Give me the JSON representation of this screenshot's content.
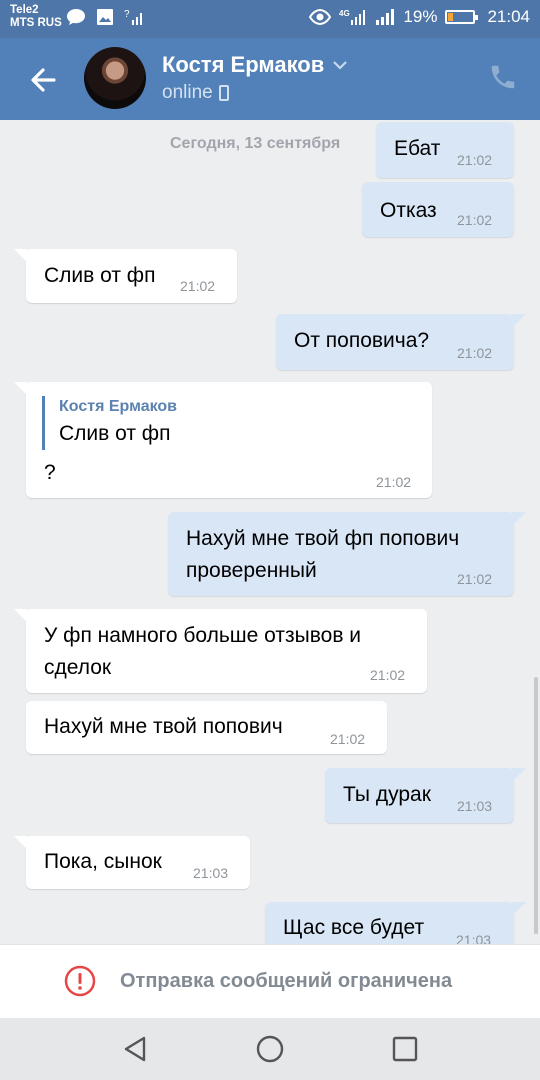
{
  "status_bar": {
    "carrier_1": "Tele2",
    "carrier_2": "MTS RUS",
    "network": "4G",
    "battery": "19%",
    "battery_level": 0.19,
    "time": "21:04",
    "left_icons": [
      "message-icon",
      "image-icon",
      "signal-unknown-icon"
    ],
    "right_icons": [
      "eye-icon",
      "4g-signal-icon",
      "signal-icon",
      "battery-icon"
    ]
  },
  "header": {
    "contact_name": "Костя Ермаков",
    "status": "online",
    "back_icon": "arrow-left-icon",
    "call_icon": "phone-icon",
    "colors": {
      "header_bg": "#5181b8",
      "status_bg": "#4f76a9"
    }
  },
  "chat": {
    "date": "Сегодня, 13 сентября",
    "messages": [
      {
        "dir": "out",
        "text": "Ебат",
        "time": "21:02"
      },
      {
        "dir": "out",
        "text": "Отказ",
        "time": "21:02"
      },
      {
        "dir": "in",
        "text": "Слив от фп",
        "time": "21:02"
      },
      {
        "dir": "out",
        "text": "От поповича?",
        "time": "21:02"
      },
      {
        "dir": "in",
        "quote_author": "Костя Ермаков",
        "quote_text": "Слив от фп",
        "text": "?",
        "time": "21:02"
      },
      {
        "dir": "out",
        "line1": "Нахуй мне твой фп попович",
        "line2": "проверенный",
        "time": "21:02"
      },
      {
        "dir": "in",
        "line1": "У фп намного больше отзывов и",
        "line2": "сделок",
        "time": "21:02"
      },
      {
        "dir": "in",
        "text": "Нахуй мне твой попович",
        "time": "21:02"
      },
      {
        "dir": "out",
        "text": "Ты дурак",
        "time": "21:03"
      },
      {
        "dir": "in",
        "text": "Пока, сынок",
        "time": "21:03"
      },
      {
        "dir": "out",
        "text": "Щас все будет",
        "time": "21:03"
      }
    ]
  },
  "composer": {
    "notice": "Отправка сообщений ограничена",
    "icon": "warning-icon",
    "icon_color": "#e64646"
  },
  "navbar": {
    "icons": [
      "back-triangle-icon",
      "home-circle-icon",
      "recents-square-icon"
    ]
  }
}
